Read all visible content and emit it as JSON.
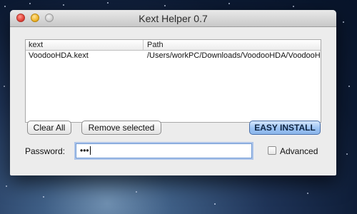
{
  "window": {
    "title": "Kext Helper 0.7"
  },
  "table": {
    "columns": [
      "kext",
      "Path"
    ],
    "rows": [
      {
        "kext": "VoodooHDA.kext",
        "path": "/Users/workPC/Downloads/VoodooHDA/VoodooHDA..."
      }
    ]
  },
  "buttons": {
    "clear_all": "Clear All",
    "remove_selected": "Remove selected",
    "easy_install": "EASY INSTALL"
  },
  "password": {
    "label": "Password:",
    "value": "•••"
  },
  "advanced": {
    "label": "Advanced",
    "checked": false
  },
  "colors": {
    "accent_button": "#9cc3f3",
    "window_bg": "#ececec"
  }
}
